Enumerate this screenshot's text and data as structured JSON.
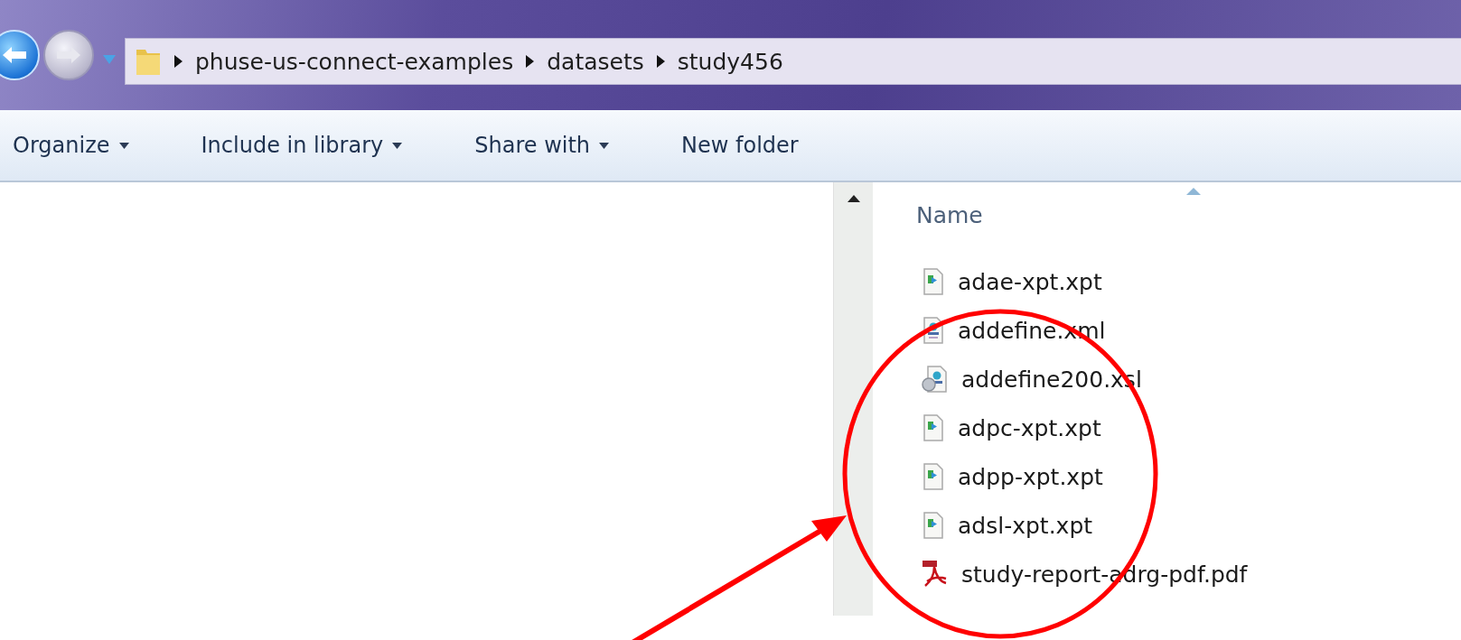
{
  "address_bar": {
    "crumbs": [
      "phuse-us-connect-examples",
      "datasets",
      "study456"
    ]
  },
  "toolbar": {
    "items": [
      {
        "label": "Organize",
        "dropdown": true
      },
      {
        "label": "Include in library",
        "dropdown": true
      },
      {
        "label": "Share with",
        "dropdown": true
      },
      {
        "label": "New folder",
        "dropdown": false
      }
    ]
  },
  "file_list": {
    "column_header": "Name",
    "files": [
      {
        "name": "adae-xpt.xpt",
        "kind": "data"
      },
      {
        "name": "addefine.xml",
        "kind": "xml"
      },
      {
        "name": "addefine200.xsl",
        "kind": "xsl"
      },
      {
        "name": "adpc-xpt.xpt",
        "kind": "data"
      },
      {
        "name": "adpp-xpt.xpt",
        "kind": "data"
      },
      {
        "name": "adsl-xpt.xpt",
        "kind": "data"
      },
      {
        "name": "study-report-adrg-pdf.pdf",
        "kind": "pdf"
      }
    ]
  }
}
